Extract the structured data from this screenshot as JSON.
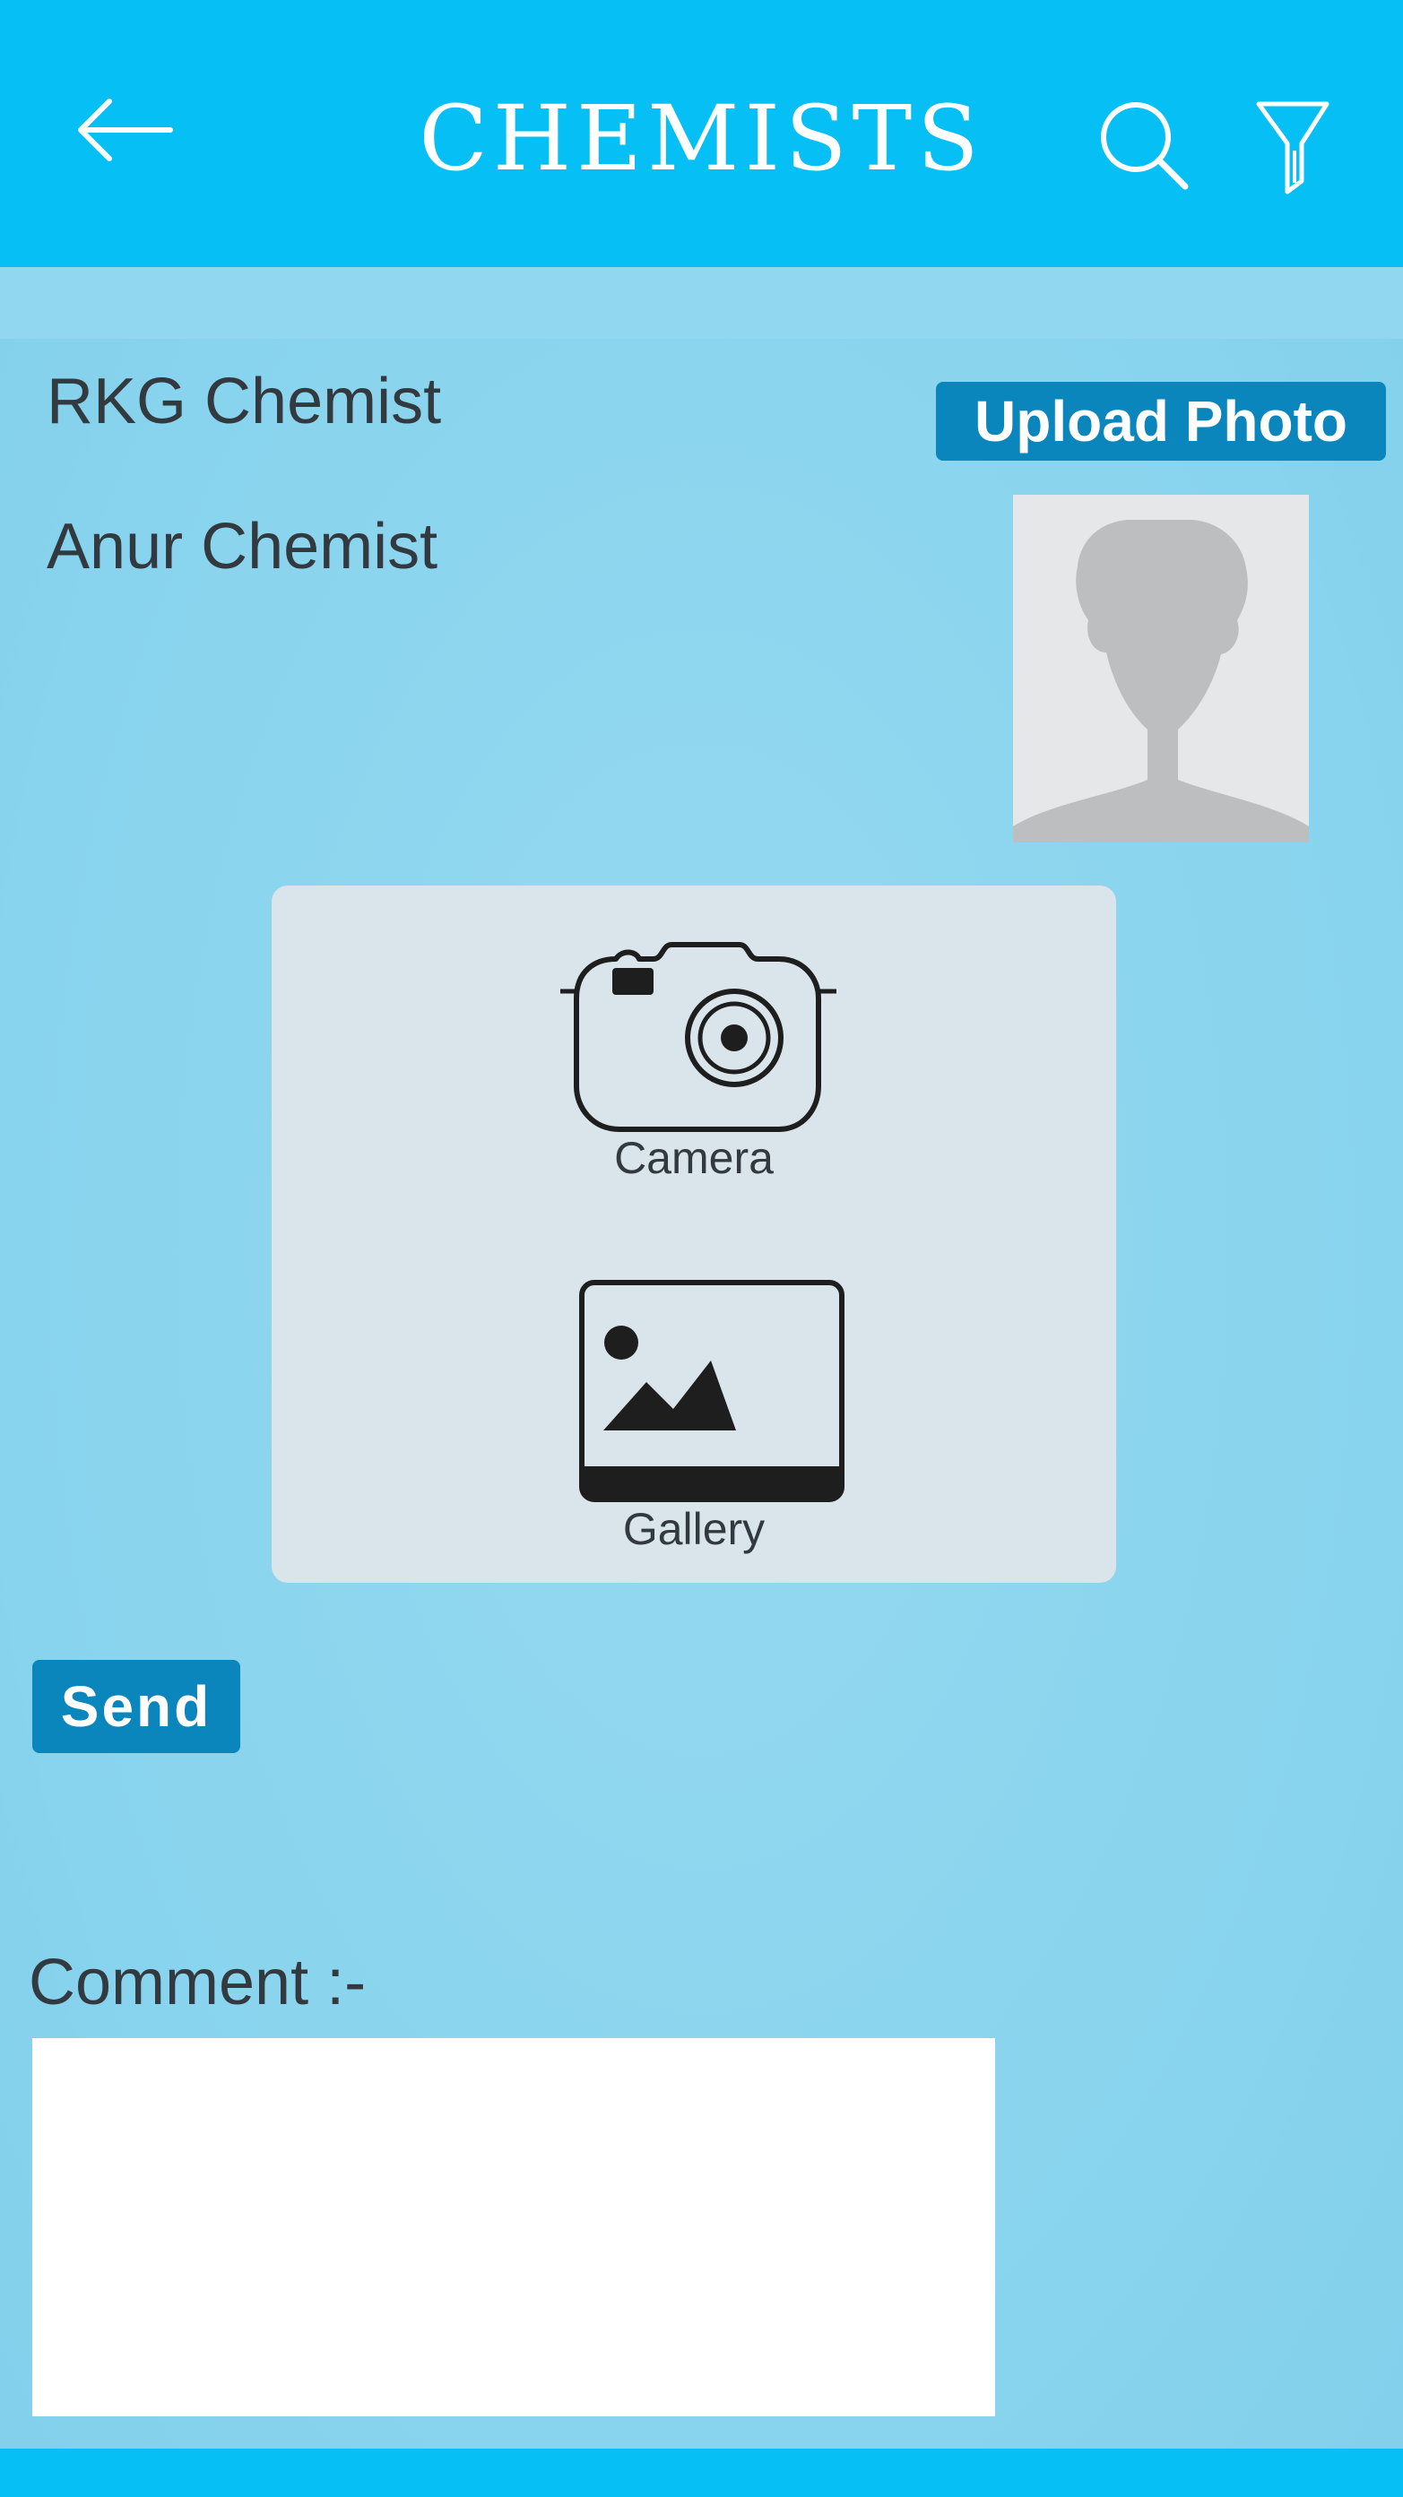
{
  "header": {
    "title": "CHEMISTS",
    "back_icon": "arrow-left-icon",
    "search_icon": "search-icon",
    "filter_icon": "filter-icon",
    "background_color": "#05bff5"
  },
  "chemists": [
    {
      "name": "RKG Chemist"
    },
    {
      "name": "Anur Chemist"
    }
  ],
  "upload": {
    "label": "Upload Photo",
    "color": "#0a86bd"
  },
  "avatar": {
    "icon": "person-placeholder-icon"
  },
  "picker": {
    "options": [
      {
        "label": "Camera",
        "icon": "camera-icon"
      },
      {
        "label": "Gallery",
        "icon": "gallery-icon"
      }
    ]
  },
  "send": {
    "label": "Send"
  },
  "comment": {
    "label": "Comment :-",
    "value": ""
  }
}
